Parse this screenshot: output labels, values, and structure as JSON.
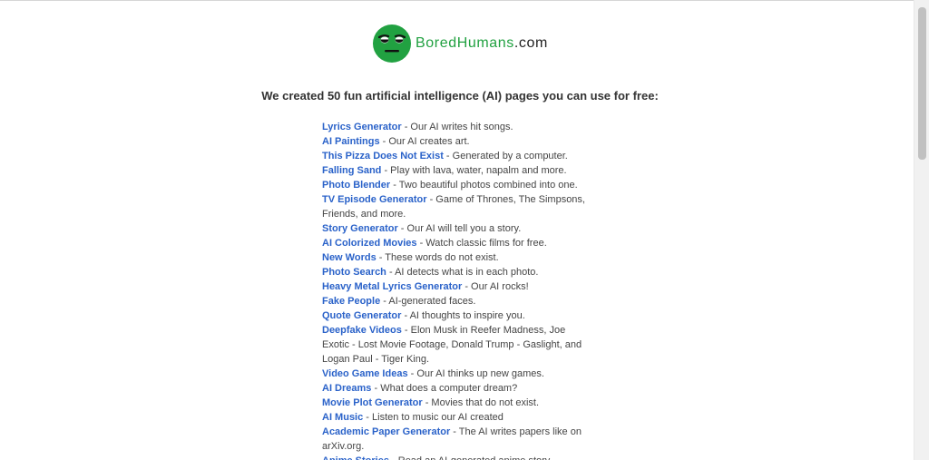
{
  "logo": {
    "text_part1": "Bored",
    "text_part2": "Humans",
    "text_part3": ".com",
    "accent_color": "#21a141",
    "icon": "bored-face-icon"
  },
  "headline": "We created 50 fun artificial intelligence (AI) pages you can use for free:",
  "items": [
    {
      "title": "Lyrics Generator",
      "desc": " - Our AI writes hit songs."
    },
    {
      "title": "AI Paintings",
      "desc": " - Our AI creates art."
    },
    {
      "title": "This Pizza Does Not Exist",
      "desc": " - Generated by a computer."
    },
    {
      "title": "Falling Sand",
      "desc": " - Play with lava, water, napalm and more."
    },
    {
      "title": "Photo Blender",
      "desc": " - Two beautiful photos combined into one."
    },
    {
      "title": "TV Episode Generator",
      "desc": " - Game of Thrones, The Simpsons, Friends, and more."
    },
    {
      "title": "Story Generator",
      "desc": " - Our AI will tell you a story."
    },
    {
      "title": "AI Colorized Movies",
      "desc": " - Watch classic films for free."
    },
    {
      "title": "New Words",
      "desc": " - These words do not exist."
    },
    {
      "title": "Photo Search",
      "desc": " - AI detects what is in each photo."
    },
    {
      "title": "Heavy Metal Lyrics Generator",
      "desc": " - Our AI rocks!"
    },
    {
      "title": "Fake People",
      "desc": " - AI-generated faces."
    },
    {
      "title": "Quote Generator",
      "desc": " - AI thoughts to inspire you."
    },
    {
      "title": "Deepfake Videos",
      "desc": " - Elon Musk in Reefer Madness, Joe Exotic - Lost Movie Footage, Donald Trump - Gaslight, and Logan Paul - Tiger King."
    },
    {
      "title": "Video Game Ideas",
      "desc": " - Our AI thinks up new games."
    },
    {
      "title": "AI Dreams",
      "desc": " - What does a computer dream?"
    },
    {
      "title": "Movie Plot Generator",
      "desc": " - Movies that do not exist."
    },
    {
      "title": "AI Music",
      "desc": " - Listen to music our AI created"
    },
    {
      "title": "Academic Paper Generator",
      "desc": " - The AI writes papers like on arXiv.org."
    },
    {
      "title": "Anime Stories",
      "desc": " - Read an AI-generated anime story."
    }
  ]
}
